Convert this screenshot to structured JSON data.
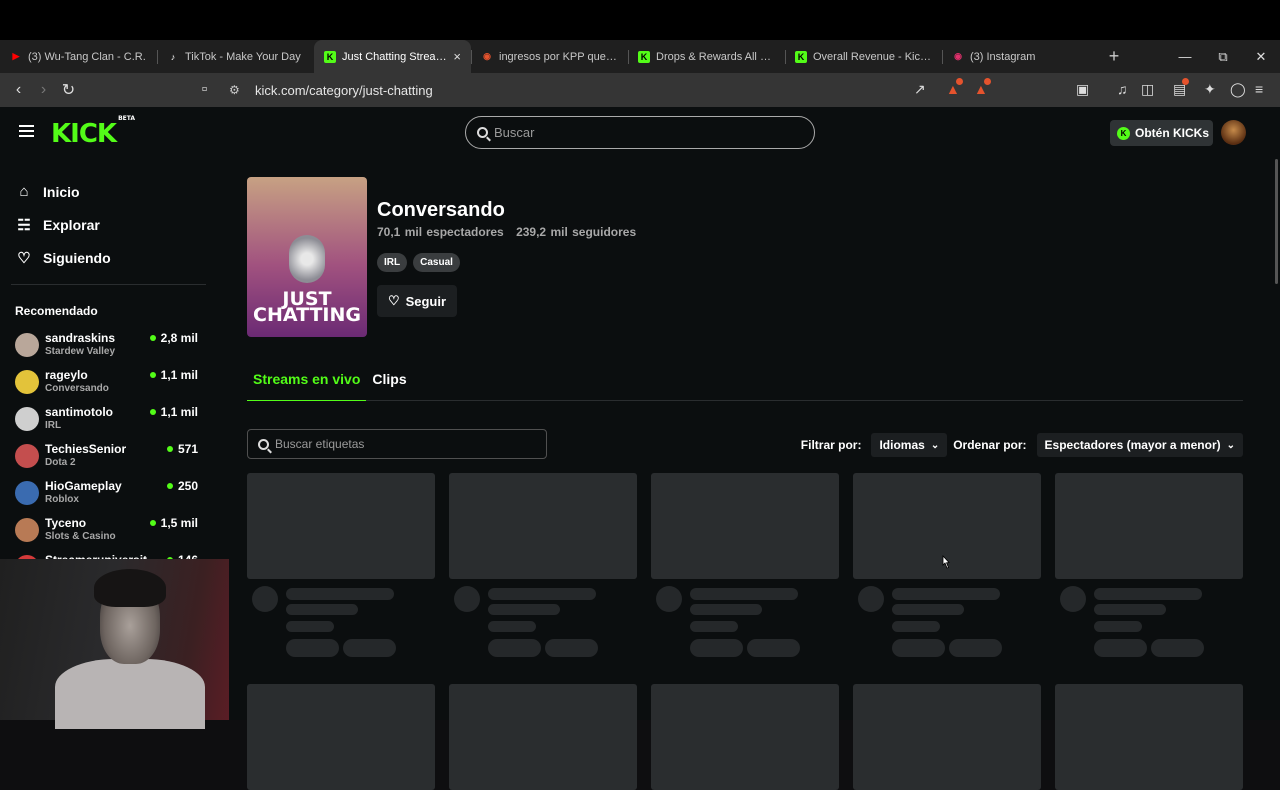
{
  "browser": {
    "tabs": [
      {
        "title": "(3) Wu-Tang Clan - C.R.",
        "icon": "youtube-icon",
        "color": "#ff0000",
        "active": false
      },
      {
        "title": "TikTok - Make Your Day",
        "icon": "tiktok-icon",
        "color": "#ffffff",
        "active": false
      },
      {
        "title": "Just Chatting Streaming",
        "icon": "kick-icon",
        "color": "#53fc18",
        "active": true
      },
      {
        "title": "ingresos por KPP que es k",
        "icon": "search-engine-icon",
        "color": "#e5532d",
        "active": false
      },
      {
        "title": "Drops & Rewards All Camp",
        "icon": "kick-icon",
        "color": "#53fc18",
        "active": false
      },
      {
        "title": "Overall Revenue - Kick Da",
        "icon": "kick-icon",
        "color": "#53fc18",
        "active": false
      },
      {
        "title": "(3) Instagram",
        "icon": "instagram-icon",
        "color": "#e1306c",
        "active": false
      }
    ],
    "url": "kick.com/category/just-chatting"
  },
  "header": {
    "search_placeholder": "Buscar",
    "get_kicks": "Obtén KICKs",
    "logo": "KICK",
    "logo_badge": "BETA"
  },
  "sidebar": {
    "nav": [
      {
        "label": "Inicio",
        "icon": "home-icon"
      },
      {
        "label": "Explorar",
        "icon": "compass-icon"
      },
      {
        "label": "Siguiendo",
        "icon": "heart-icon"
      }
    ],
    "recommended_title": "Recomendado",
    "recommended": [
      {
        "name": "sandraskins",
        "category": "Stardew Valley",
        "viewers": "2,8 mil",
        "avatar_color": "#b9a79a"
      },
      {
        "name": "rageylo",
        "category": "Conversando",
        "viewers": "1,1 mil",
        "avatar_color": "#e3c33a"
      },
      {
        "name": "santimotolo",
        "category": "IRL",
        "viewers": "1,1 mil",
        "avatar_color": "#cfcfcf"
      },
      {
        "name": "TechiesSenior",
        "category": "Dota 2",
        "viewers": "571",
        "avatar_color": "#c44e4e"
      },
      {
        "name": "HioGameplay",
        "category": "Roblox",
        "viewers": "250",
        "avatar_color": "#3a6bb0"
      },
      {
        "name": "Tyceno",
        "category": "Slots & Casino",
        "viewers": "1,5 mil",
        "avatar_color": "#b87a55"
      },
      {
        "name": "Streameruniversit...",
        "category": "",
        "viewers": "146",
        "avatar_color": "#d33a3a"
      }
    ]
  },
  "category": {
    "title": "Conversando",
    "viewers": "70,1 mil espectadores",
    "followers": "239,2 mil seguidores",
    "tags": [
      "IRL",
      "Casual"
    ],
    "follow_label": "Seguir",
    "cover_text": "JUST CHATTING"
  },
  "page_tabs": [
    {
      "label": "Streams en vivo",
      "active": true
    },
    {
      "label": "Clips",
      "active": false
    }
  ],
  "filters": {
    "tag_search_placeholder": "Buscar etiquetas",
    "filter_label": "Filtrar por:",
    "filter_value": "Idiomas",
    "sort_label": "Ordenar por:",
    "sort_value": "Espectadores (mayor a menor)"
  },
  "colors": {
    "brand_green": "#53fc18",
    "background": "#0b0e0f",
    "skeleton": "#2a2d2f"
  }
}
